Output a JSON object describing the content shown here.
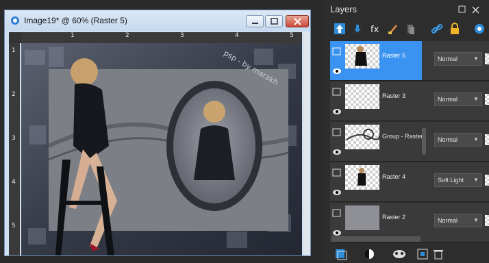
{
  "document": {
    "title": "Image19* @  60% (Raster 5)",
    "ruler_top": [
      "1",
      "2",
      "3",
      "4",
      "5"
    ],
    "ruler_left": [
      "1",
      "2",
      "3",
      "4",
      "5"
    ],
    "watermark": "psp - by marakh",
    "close_symbol": "✕"
  },
  "layers_panel": {
    "title": "Layers",
    "toolbar_icons": [
      "new-raster-layer-icon",
      "new-vector-layer-icon",
      "new-mask-layer-icon",
      "paint-icon",
      "duplicate-icon",
      "link-icon",
      "lock-icon",
      "visibility-icon"
    ],
    "rows": [
      {
        "name": "Raster 5",
        "blend": "Normal",
        "selected": true
      },
      {
        "name": "Raster 3",
        "blend": "Normal",
        "selected": false
      },
      {
        "name": "Group - Raster",
        "blend": "Normal",
        "selected": false
      },
      {
        "name": "Raster 4",
        "blend": "Soft Light",
        "selected": false
      },
      {
        "name": "Raster 2",
        "blend": "Normal",
        "selected": false
      }
    ]
  },
  "colors": {
    "selection": "#3a93f0",
    "panel_bg": "#2d2d2d",
    "title_bar": "#cfe0f2"
  }
}
